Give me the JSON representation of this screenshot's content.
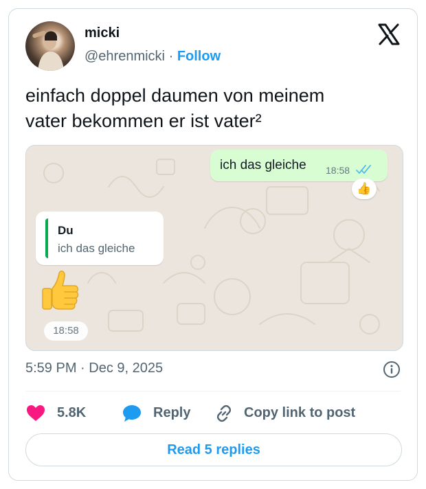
{
  "post": {
    "author_name": "micki",
    "handle": "@ehrenmicki",
    "separator": "·",
    "follow_label": "Follow",
    "text_line1": "einfach doppel daumen von meinem",
    "text_line2": "vater bekommen er ist vater²",
    "timestamp": "5:59 PM · Dec 9, 2025"
  },
  "chat": {
    "outgoing": {
      "text": "ich das gleiche",
      "time": "18:58",
      "reaction": "👍"
    },
    "incoming": {
      "quote_author": "Du",
      "quote_text": "ich das gleiche",
      "sticker": "👍",
      "time": "18:58"
    }
  },
  "actions": {
    "likes_count": "5.8K",
    "reply_label": "Reply",
    "copy_link_label": "Copy link to post"
  },
  "read_replies_label": "Read 5 replies",
  "icons": {
    "brand": "x-logo-icon",
    "like": "heart-icon",
    "reply": "speech-bubble-icon",
    "link": "link-icon",
    "info": "info-icon"
  },
  "colors": {
    "accent": "#1d9bf0",
    "like": "#f91880",
    "reply": "#1d9bf0",
    "muted": "#536471",
    "outgoing_bubble": "#d9fdd3",
    "chat_background": "#ece5dd",
    "quote_bar": "#06a94d"
  }
}
